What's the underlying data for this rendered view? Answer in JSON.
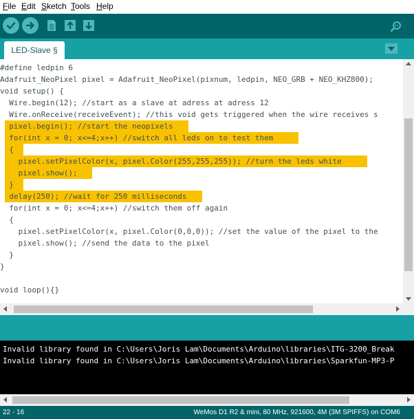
{
  "menu": [
    {
      "underline": "F",
      "rest": "ile"
    },
    {
      "underline": "E",
      "rest": "dit"
    },
    {
      "underline": "S",
      "rest": "ketch"
    },
    {
      "underline": "T",
      "rest": "ools"
    },
    {
      "underline": "H",
      "rest": "elp"
    }
  ],
  "toolbar": {
    "verify_icon": "check-icon",
    "upload_icon": "arrow-right-icon",
    "new_icon": "new-file-icon",
    "open_icon": "arrow-up-icon",
    "save_icon": "arrow-down-icon",
    "serial_icon": "magnifier-icon"
  },
  "tab": {
    "label": "LED-Slave §"
  },
  "code_lines": [
    "#define ledpin 6",
    "Adafruit_NeoPixel pixel = Adafruit_NeoPixel(pixnum, ledpin, NEO_GRB + NEO_KHZ800);",
    "void setup() {",
    "  Wire.begin(12); //start as a slave at adress at adress 12",
    "  Wire.onReceive(receiveEvent); //this void gets triggered when the wire receives s",
    "  pixel.begin(); //start the neopixels",
    "  for(int x = 0; x<=4;x++) //switch all leds on to test them",
    "  {",
    "    pixel.setPixelColor(x, pixel.Color(255,255,255)); //turn the leds white",
    "    pixel.show();",
    "  }",
    "  delay(250); //wait for 250 milliseconds",
    "  for(int x = 0; x<=4;x++) //switch them off again",
    "  {",
    "    pixel.setPixelColor(x, pixel.Color(0,0,0)); //set the value of the pixel to the",
    "    pixel.show(); //send the data to the pixel",
    "  }",
    "}",
    "",
    "void loop(){}"
  ],
  "console_lines": [
    "Invalid library found in C:\\Users\\Joris Lam\\Documents\\Arduino\\libraries\\ITG-3200_Break",
    "Invalid library found in C:\\Users\\Joris Lam\\Documents\\Arduino\\libraries\\Sparkfun-MP3-P"
  ],
  "status": {
    "position": "22 - 16",
    "board": "WeMos D1 R2 & mini, 80 MHz, 921600, 4M (3M SPIFFS) on COM6"
  },
  "colors": {
    "toolbar": "#006468",
    "tabbar": "#17a1a5",
    "selection": "#f8c200",
    "console": "#000000"
  }
}
